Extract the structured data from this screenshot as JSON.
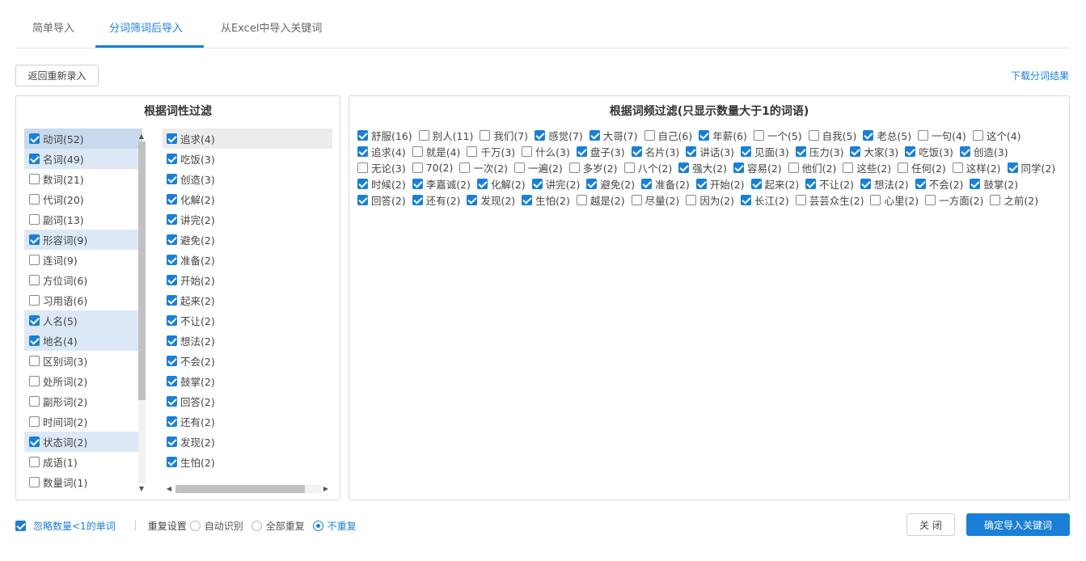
{
  "tabs": [
    {
      "label": "简单导入",
      "active": false
    },
    {
      "label": "分词筛词后导入",
      "active": true
    },
    {
      "label": "从Excel中导入关键词",
      "active": false
    }
  ],
  "toolbar": {
    "back_label": "返回重新录入",
    "download_label": "下载分词结果"
  },
  "left_panel": {
    "title": "根据词性过滤",
    "pos_items": [
      {
        "label": "动词(52)",
        "checked": true
      },
      {
        "label": "名词(49)",
        "checked": true
      },
      {
        "label": "数词(21)",
        "checked": false
      },
      {
        "label": "代词(20)",
        "checked": false
      },
      {
        "label": "副词(13)",
        "checked": false
      },
      {
        "label": "形容词(9)",
        "checked": true
      },
      {
        "label": "连词(9)",
        "checked": false
      },
      {
        "label": "方位词(6)",
        "checked": false
      },
      {
        "label": "习用语(6)",
        "checked": false
      },
      {
        "label": "人名(5)",
        "checked": true
      },
      {
        "label": "地名(4)",
        "checked": true
      },
      {
        "label": "区别词(3)",
        "checked": false
      },
      {
        "label": "处所词(2)",
        "checked": false
      },
      {
        "label": "副形词(2)",
        "checked": false
      },
      {
        "label": "时间词(2)",
        "checked": false
      },
      {
        "label": "状态词(2)",
        "checked": true
      },
      {
        "label": "成语(1)",
        "checked": false
      },
      {
        "label": "数量词(1)",
        "checked": false
      }
    ],
    "word_items": [
      {
        "label": "追求(4)",
        "checked": true
      },
      {
        "label": "吃饭(3)",
        "checked": true
      },
      {
        "label": "创造(3)",
        "checked": true
      },
      {
        "label": "化解(2)",
        "checked": true
      },
      {
        "label": "讲完(2)",
        "checked": true
      },
      {
        "label": "避免(2)",
        "checked": true
      },
      {
        "label": "准备(2)",
        "checked": true
      },
      {
        "label": "开始(2)",
        "checked": true
      },
      {
        "label": "起来(2)",
        "checked": true
      },
      {
        "label": "不让(2)",
        "checked": true
      },
      {
        "label": "想法(2)",
        "checked": true
      },
      {
        "label": "不会(2)",
        "checked": true
      },
      {
        "label": "鼓掌(2)",
        "checked": true
      },
      {
        "label": "回答(2)",
        "checked": true
      },
      {
        "label": "还有(2)",
        "checked": true
      },
      {
        "label": "发现(2)",
        "checked": true
      },
      {
        "label": "生怕(2)",
        "checked": true
      }
    ]
  },
  "right_panel": {
    "title": "根据词频过滤(只显示数量大于1的词语)",
    "items": [
      {
        "label": "舒服(16)",
        "checked": true
      },
      {
        "label": "别人(11)",
        "checked": false
      },
      {
        "label": "我们(7)",
        "checked": false
      },
      {
        "label": "感觉(7)",
        "checked": true
      },
      {
        "label": "大哥(7)",
        "checked": true
      },
      {
        "label": "自己(6)",
        "checked": false
      },
      {
        "label": "年薪(6)",
        "checked": true
      },
      {
        "label": "一个(5)",
        "checked": false
      },
      {
        "label": "自我(5)",
        "checked": false
      },
      {
        "label": "老总(5)",
        "checked": true
      },
      {
        "label": "一句(4)",
        "checked": false
      },
      {
        "label": "这个(4)",
        "checked": false
      },
      {
        "label": "追求(4)",
        "checked": true
      },
      {
        "label": "就是(4)",
        "checked": false
      },
      {
        "label": "千万(3)",
        "checked": false
      },
      {
        "label": "什么(3)",
        "checked": false
      },
      {
        "label": "盘子(3)",
        "checked": true
      },
      {
        "label": "名片(3)",
        "checked": true
      },
      {
        "label": "讲话(3)",
        "checked": true
      },
      {
        "label": "见面(3)",
        "checked": true
      },
      {
        "label": "压力(3)",
        "checked": true
      },
      {
        "label": "大家(3)",
        "checked": true
      },
      {
        "label": "吃饭(3)",
        "checked": true
      },
      {
        "label": "创造(3)",
        "checked": true
      },
      {
        "label": "无论(3)",
        "checked": false
      },
      {
        "label": "70(2)",
        "checked": false
      },
      {
        "label": "一次(2)",
        "checked": false
      },
      {
        "label": "一遍(2)",
        "checked": false
      },
      {
        "label": "多岁(2)",
        "checked": false
      },
      {
        "label": "八个(2)",
        "checked": false
      },
      {
        "label": "强大(2)",
        "checked": true
      },
      {
        "label": "容易(2)",
        "checked": true
      },
      {
        "label": "他们(2)",
        "checked": false
      },
      {
        "label": "这些(2)",
        "checked": false
      },
      {
        "label": "任何(2)",
        "checked": false
      },
      {
        "label": "这样(2)",
        "checked": false
      },
      {
        "label": "同学(2)",
        "checked": true
      },
      {
        "label": "时候(2)",
        "checked": true
      },
      {
        "label": "李嘉诚(2)",
        "checked": true
      },
      {
        "label": "化解(2)",
        "checked": true
      },
      {
        "label": "讲完(2)",
        "checked": true
      },
      {
        "label": "避免(2)",
        "checked": true
      },
      {
        "label": "准备(2)",
        "checked": true
      },
      {
        "label": "开始(2)",
        "checked": true
      },
      {
        "label": "起来(2)",
        "checked": true
      },
      {
        "label": "不让(2)",
        "checked": true
      },
      {
        "label": "想法(2)",
        "checked": true
      },
      {
        "label": "不会(2)",
        "checked": true
      },
      {
        "label": "鼓掌(2)",
        "checked": true
      },
      {
        "label": "回答(2)",
        "checked": true
      },
      {
        "label": "还有(2)",
        "checked": true
      },
      {
        "label": "发现(2)",
        "checked": true
      },
      {
        "label": "生怕(2)",
        "checked": true
      },
      {
        "label": "越是(2)",
        "checked": false
      },
      {
        "label": "尽量(2)",
        "checked": false
      },
      {
        "label": "因为(2)",
        "checked": false
      },
      {
        "label": "长江(2)",
        "checked": true
      },
      {
        "label": "芸芸众生(2)",
        "checked": false
      },
      {
        "label": "心里(2)",
        "checked": false
      },
      {
        "label": "一方面(2)",
        "checked": false
      },
      {
        "label": "之前(2)",
        "checked": false
      }
    ]
  },
  "bottom": {
    "ignore_label": "忽略数量<1的单词",
    "ignore_checked": true,
    "repeat_label": "重复设置",
    "radios": [
      {
        "label": "自动识别",
        "selected": false
      },
      {
        "label": "全部重复",
        "selected": false
      },
      {
        "label": "不重复",
        "selected": true
      }
    ],
    "close_label": "关 闭",
    "confirm_label": "确定导入关键词"
  },
  "colors": {
    "accent": "#1a7fd6",
    "selected_row": "#dde8f7"
  }
}
